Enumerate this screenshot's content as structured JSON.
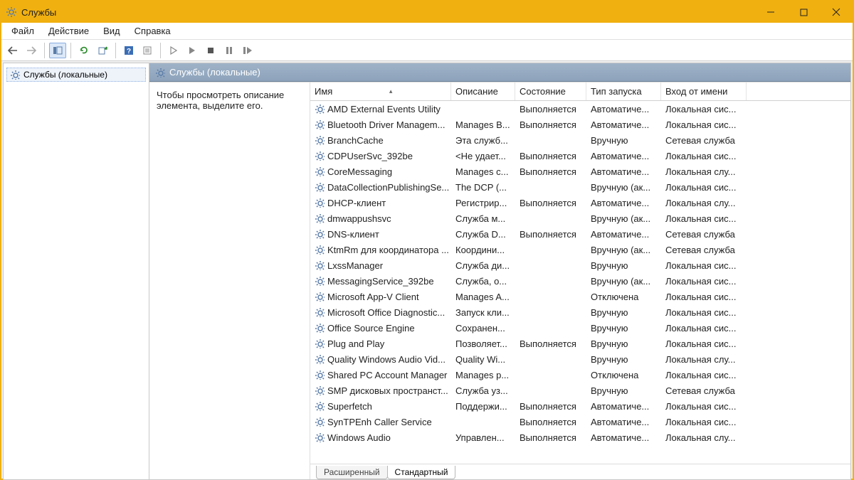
{
  "window": {
    "title": "Службы"
  },
  "menu": {
    "file": "Файл",
    "action": "Действие",
    "view": "Вид",
    "help": "Справка"
  },
  "tree": {
    "root": "Службы (локальные)"
  },
  "panel": {
    "header": "Службы (локальные)",
    "hint": "Чтобы просмотреть описание элемента, выделите его."
  },
  "columns": {
    "name": "Имя",
    "description": "Описание",
    "status": "Состояние",
    "startup": "Тип запуска",
    "logon": "Вход от имени"
  },
  "tabs": {
    "extended": "Расширенный",
    "standard": "Стандартный"
  },
  "services": [
    {
      "name": "AMD External Events Utility",
      "desc": "",
      "status": "Выполняется",
      "startup": "Автоматиче...",
      "logon": "Локальная сис..."
    },
    {
      "name": "Bluetooth Driver Managem...",
      "desc": "Manages B...",
      "status": "Выполняется",
      "startup": "Автоматиче...",
      "logon": "Локальная сис..."
    },
    {
      "name": "BranchCache",
      "desc": "Эта служб...",
      "status": "",
      "startup": "Вручную",
      "logon": "Сетевая служба"
    },
    {
      "name": "CDPUserSvc_392be",
      "desc": "<Не удает...",
      "status": "Выполняется",
      "startup": "Автоматиче...",
      "logon": "Локальная сис..."
    },
    {
      "name": "CoreMessaging",
      "desc": "Manages c...",
      "status": "Выполняется",
      "startup": "Автоматиче...",
      "logon": "Локальная слу..."
    },
    {
      "name": "DataCollectionPublishingSe...",
      "desc": "The DCP (...",
      "status": "",
      "startup": "Вручную (ак...",
      "logon": "Локальная сис..."
    },
    {
      "name": "DHCP-клиент",
      "desc": "Регистрир...",
      "status": "Выполняется",
      "startup": "Автоматиче...",
      "logon": "Локальная слу..."
    },
    {
      "name": "dmwappushsvc",
      "desc": "Служба м...",
      "status": "",
      "startup": "Вручную (ак...",
      "logon": "Локальная сис..."
    },
    {
      "name": "DNS-клиент",
      "desc": "Служба D...",
      "status": "Выполняется",
      "startup": "Автоматиче...",
      "logon": "Сетевая служба"
    },
    {
      "name": "KtmRm для координатора ...",
      "desc": "Координи...",
      "status": "",
      "startup": "Вручную (ак...",
      "logon": "Сетевая служба"
    },
    {
      "name": "LxssManager",
      "desc": "Служба ди...",
      "status": "",
      "startup": "Вручную",
      "logon": "Локальная сис..."
    },
    {
      "name": "MessagingService_392be",
      "desc": "Служба, о...",
      "status": "",
      "startup": "Вручную (ак...",
      "logon": "Локальная сис..."
    },
    {
      "name": "Microsoft App-V Client",
      "desc": "Manages A...",
      "status": "",
      "startup": "Отключена",
      "logon": "Локальная сис..."
    },
    {
      "name": "Microsoft Office Diagnostic...",
      "desc": "Запуск кли...",
      "status": "",
      "startup": "Вручную",
      "logon": "Локальная сис..."
    },
    {
      "name": "Office Source Engine",
      "desc": "Сохранен...",
      "status": "",
      "startup": "Вручную",
      "logon": "Локальная сис..."
    },
    {
      "name": "Plug and Play",
      "desc": "Позволяет...",
      "status": "Выполняется",
      "startup": "Вручную",
      "logon": "Локальная сис..."
    },
    {
      "name": "Quality Windows Audio Vid...",
      "desc": "Quality Wi...",
      "status": "",
      "startup": "Вручную",
      "logon": "Локальная слу..."
    },
    {
      "name": "Shared PC Account Manager",
      "desc": "Manages p...",
      "status": "",
      "startup": "Отключена",
      "logon": "Локальная сис..."
    },
    {
      "name": "SMP дисковых пространст...",
      "desc": "Служба уз...",
      "status": "",
      "startup": "Вручную",
      "logon": "Сетевая служба"
    },
    {
      "name": "Superfetch",
      "desc": "Поддержи...",
      "status": "Выполняется",
      "startup": "Автоматиче...",
      "logon": "Локальная сис..."
    },
    {
      "name": "SynTPEnh Caller Service",
      "desc": "",
      "status": "Выполняется",
      "startup": "Автоматиче...",
      "logon": "Локальная сис..."
    },
    {
      "name": "Windows Audio",
      "desc": "Управлен...",
      "status": "Выполняется",
      "startup": "Автоматиче...",
      "logon": "Локальная слу..."
    }
  ]
}
